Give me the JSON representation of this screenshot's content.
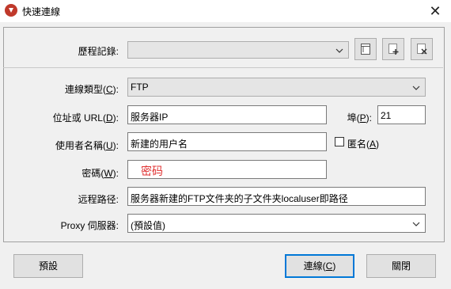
{
  "window": {
    "title": "快速連線",
    "close_glyph": "✕"
  },
  "history": {
    "label": "歷程記錄:",
    "value": ""
  },
  "conn_type": {
    "label": "連線類型(",
    "key": "C",
    "suffix": "):",
    "value": "FTP"
  },
  "address": {
    "label": "位址或 URL(",
    "key": "D",
    "suffix": "):",
    "value": "服务器IP"
  },
  "port": {
    "label": "埠(",
    "key": "P",
    "suffix": "):",
    "value": "21"
  },
  "username": {
    "label": "使用者名稱(",
    "key": "U",
    "suffix": "):",
    "value": "新建的用户名"
  },
  "anonymous": {
    "label": "匿名(",
    "key": "A",
    "suffix": ")",
    "checked": false
  },
  "password": {
    "label": "密碼(",
    "key": "W",
    "suffix": "):",
    "value": "密码",
    "value_color": "#e03030"
  },
  "remote_path": {
    "label": "远程路径:",
    "value": "服务器新建的FTP文件夹的子文件夹localuser即路径"
  },
  "proxy": {
    "label": "Proxy 伺服器:",
    "value": "(預設值)"
  },
  "buttons": {
    "default": "預設",
    "connect": "連線(",
    "connect_key": "C",
    "connect_suffix": ")",
    "close": "關閉"
  },
  "icons": {
    "app": "app-logo-icon",
    "tool1": "document-icon",
    "tool2": "add-document-icon",
    "tool3": "delete-document-icon",
    "chevron": "chevron-down-icon"
  },
  "colors": {
    "accent": "#0078d7",
    "app_icon": "#c0392b"
  }
}
